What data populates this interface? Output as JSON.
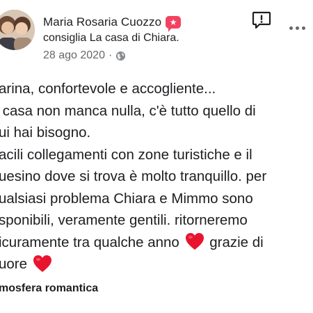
{
  "post": {
    "author": "Maria Rosaria Cuozzo",
    "recommend_prefix": "consiglia",
    "place": "La casa di Chiara",
    "place_suffix": ".",
    "date": "28 ago 2020",
    "dot": "·",
    "icons": {
      "recommend": "recommend-badge-icon",
      "privacy": "globe-icon",
      "report": "report-icon",
      "more": "more-options-icon",
      "heart": "heart-emoji-icon"
    },
    "body_lines": [
      "arina, confortevole e accogliente...",
      " casa non manca nulla, c'è tutto quello di",
      "ui hai bisogno.",
      "acili collegamenti con zone turistiche e il",
      "uesino dove si trova è molto tranquillo. per",
      "ualsiasi problema Chiara e Mimmo sono",
      "sponibili, veramente gentili. ritorneremo"
    ],
    "line8_before": "icuramente tra qualche anno ",
    "line8_after": " grazie di",
    "line9_before": "uore ",
    "tag": "mosfera romantica"
  },
  "colors": {
    "text": "#1c1e21",
    "secondary": "#65676b",
    "recommend_badge": "#f3425f",
    "heart": "#e8142e"
  }
}
